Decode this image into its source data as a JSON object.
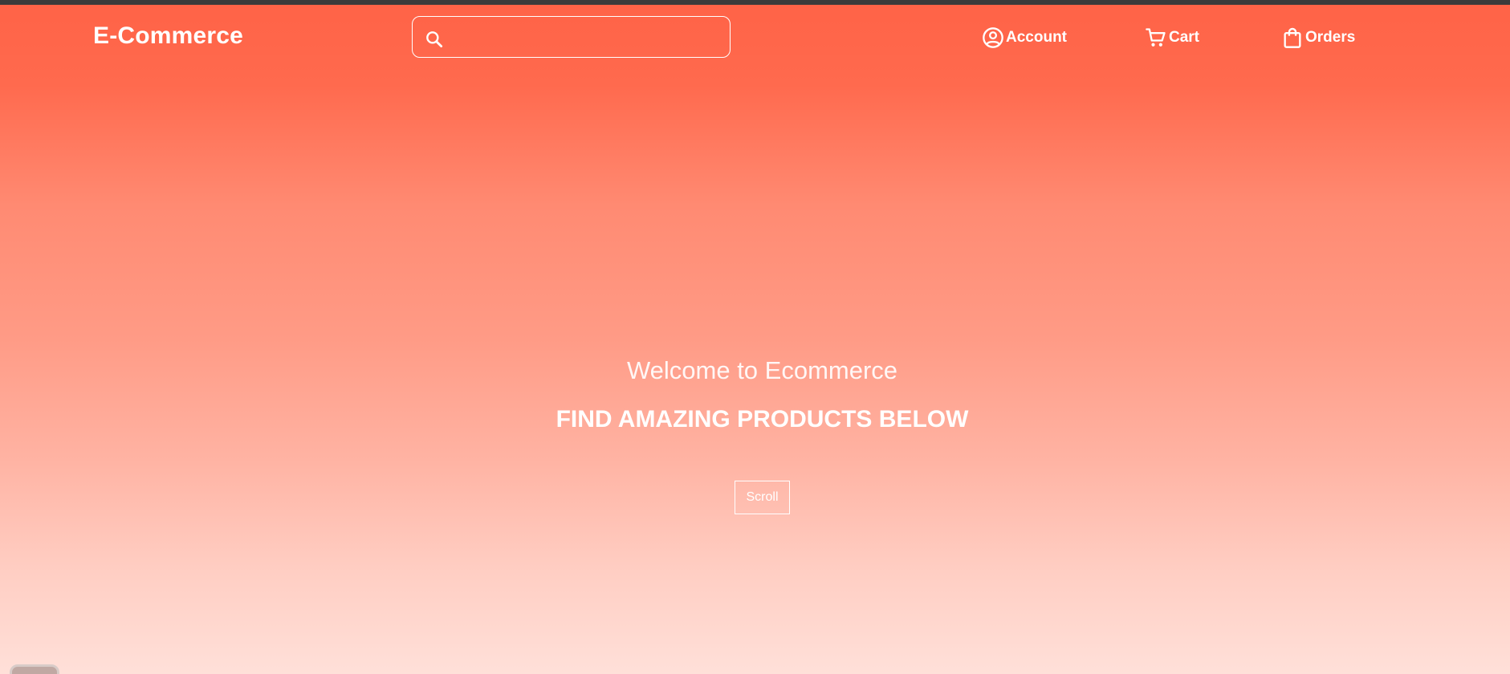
{
  "header": {
    "logo": "E-Commerce",
    "search": {
      "value": "",
      "placeholder": ""
    },
    "nav": [
      {
        "label": "Account",
        "icon": "account-circle-icon"
      },
      {
        "label": "Cart",
        "icon": "shopping-cart-icon"
      },
      {
        "label": "Orders",
        "icon": "shopping-bag-icon"
      }
    ]
  },
  "hero": {
    "welcome": "Welcome to Ecommerce",
    "tagline": "FIND AMAZING PRODUCTS BELOW",
    "scroll_label": "Scroll"
  },
  "colors": {
    "gradient_top": "#ff6347",
    "gradient_bottom": "#ffe0d9",
    "text": "#ffffff",
    "top_strip": "#3b3b3b"
  }
}
